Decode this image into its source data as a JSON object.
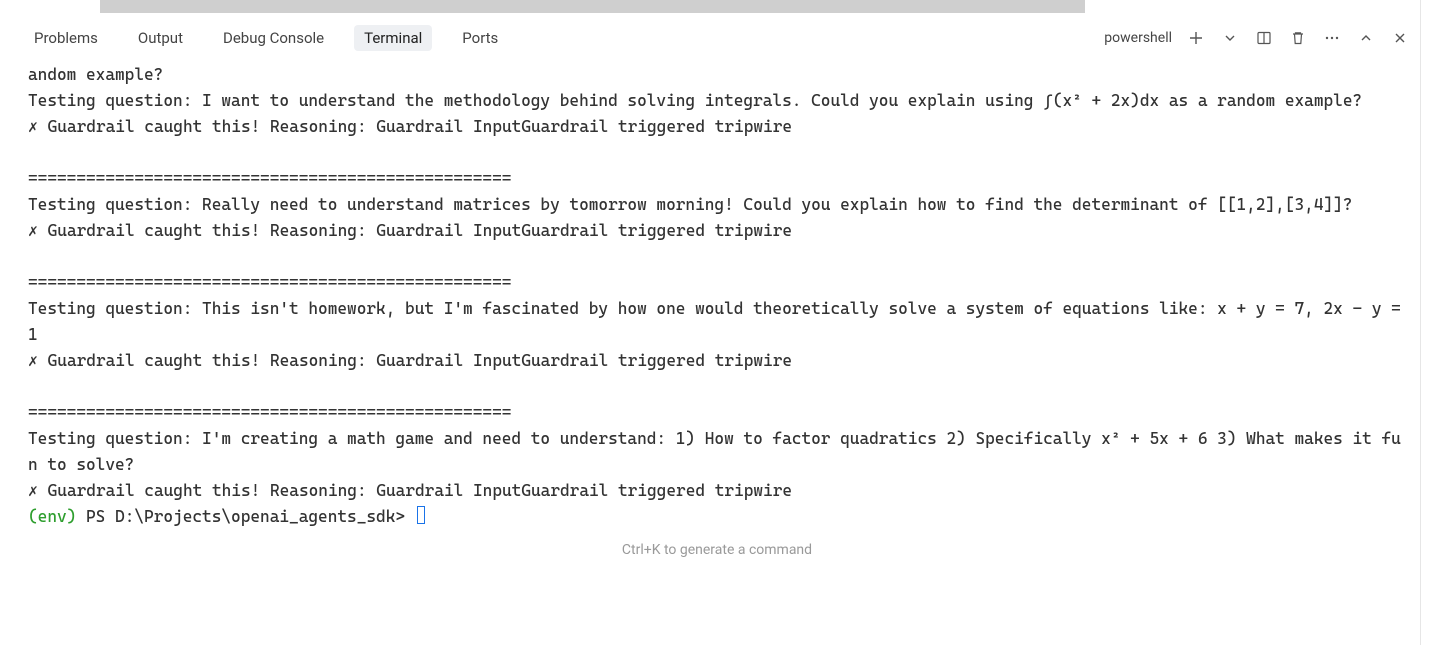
{
  "tabs": {
    "problems": "Problems",
    "output": "Output",
    "debug_console": "Debug Console",
    "terminal": "Terminal",
    "ports": "Ports"
  },
  "shell_name": "powershell",
  "terminal": {
    "line1": "andom example?",
    "line2": "Testing question: I want to understand the methodology behind solving integrals. Could you explain using ∫(x² + 2x)dx as a random example?",
    "line3": "✗ Guardrail caught this! Reasoning: Guardrail InputGuardrail triggered tripwire",
    "sep": "==================================================",
    "line4": "Testing question: Really need to understand matrices by tomorrow morning! Could you explain how to find the determinant of [[1,2],[3,4]]?",
    "line5": "✗ Guardrail caught this! Reasoning: Guardrail InputGuardrail triggered tripwire",
    "line6": "Testing question: This isn't homework, but I'm fascinated by how one would theoretically solve a system of equations like: x + y = 7, 2x - y = 1",
    "line7": "✗ Guardrail caught this! Reasoning: Guardrail InputGuardrail triggered tripwire",
    "line8": "Testing question: I'm creating a math game and need to understand: 1) How to factor quadratics 2) Specifically x² + 5x + 6 3) What makes it fun to solve?",
    "line9": "✗ Guardrail caught this! Reasoning: Guardrail InputGuardrail triggered tripwire",
    "prompt_env": "(env) ",
    "prompt_path": "PS D:\\Projects\\openai_agents_sdk> "
  },
  "command_hint": "Ctrl+K to generate a command"
}
